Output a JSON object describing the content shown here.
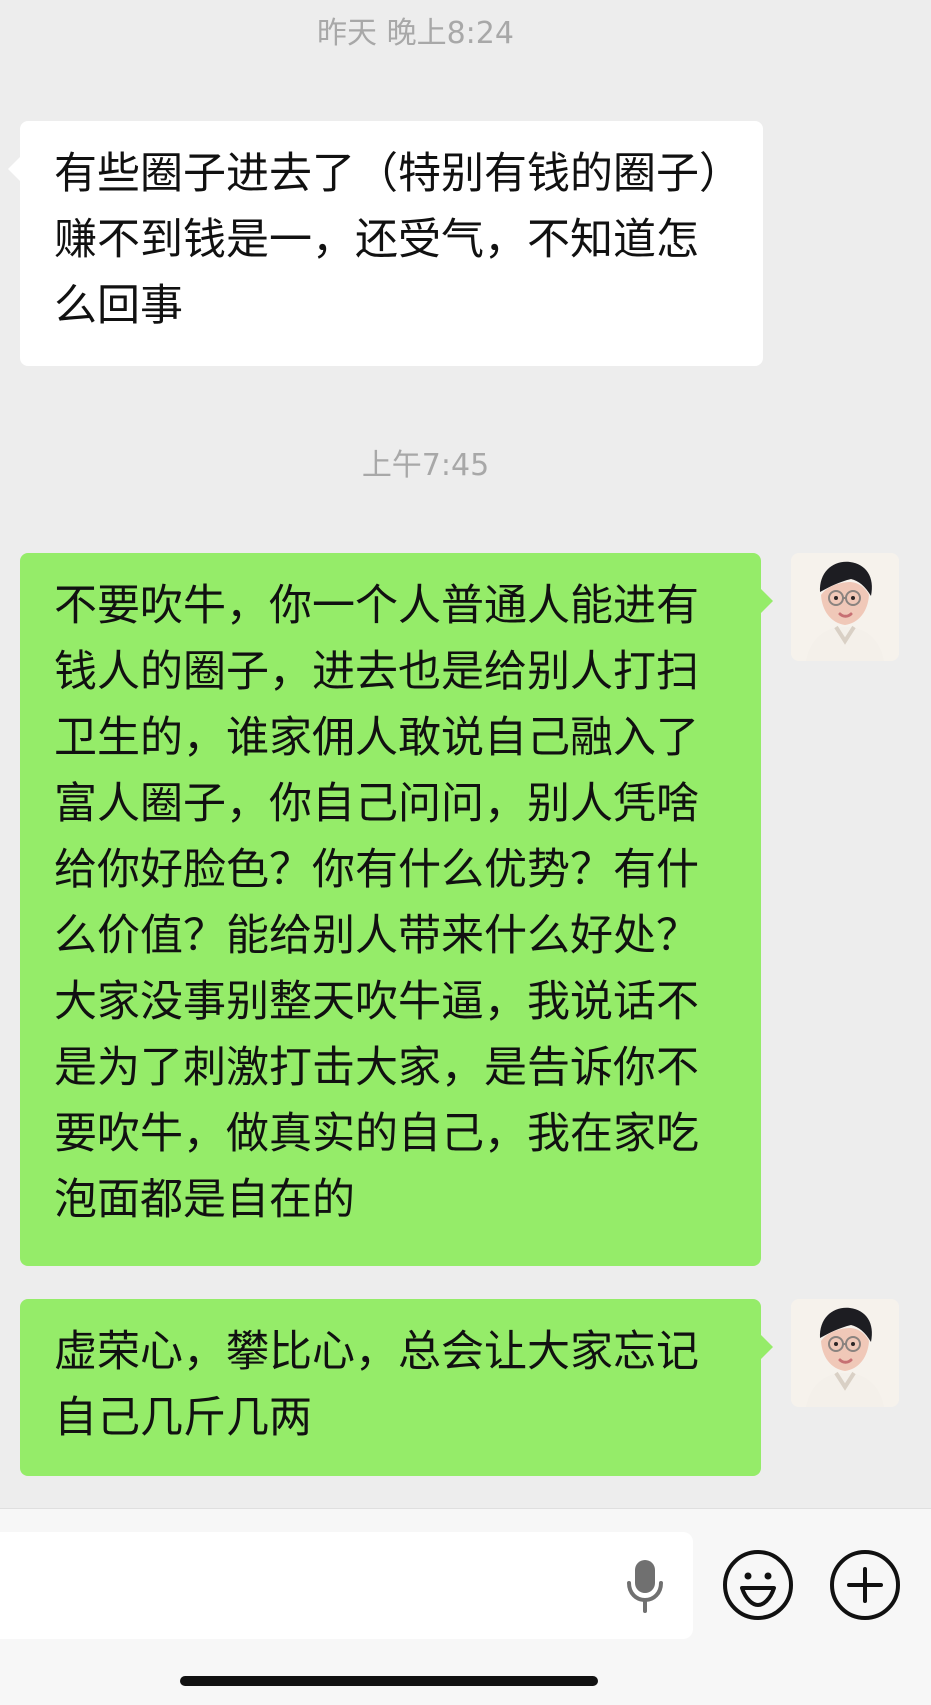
{
  "chat": {
    "timestamps": [
      "昨天 晚上8:24",
      "上午7:45"
    ],
    "messages": [
      {
        "side": "incoming",
        "text": "有些圈子进去了（特别有钱的圈子）赚不到钱是一，还受气，不知道怎么回事"
      },
      {
        "side": "outgoing",
        "text": "不要吹牛，你一个人普通人能进有钱人的圈子，进去也是给别人打扫卫生的，谁家佣人敢说自己融入了富人圈子，你自己问问，别人凭啥给你好脸色？你有什么优势？有什么价值？能给别人带来什么好处？大家没事别整天吹牛逼，我说话不是为了刺激打击大家，是告诉你不要吹牛，做真实的自己，我在家吃泡面都是自在的"
      },
      {
        "side": "outgoing",
        "text": "虚荣心，攀比心，总会让大家忘记自己几斤几两"
      }
    ],
    "colors": {
      "background": "#ededed",
      "incoming_bubble": "#ffffff",
      "outgoing_bubble": "#95ec69",
      "timestamp": "#a8a8a8"
    }
  },
  "input_bar": {
    "value": "",
    "icons": {
      "voice": "microphone-icon",
      "emoji": "smile-icon",
      "more": "plus-icon"
    }
  }
}
